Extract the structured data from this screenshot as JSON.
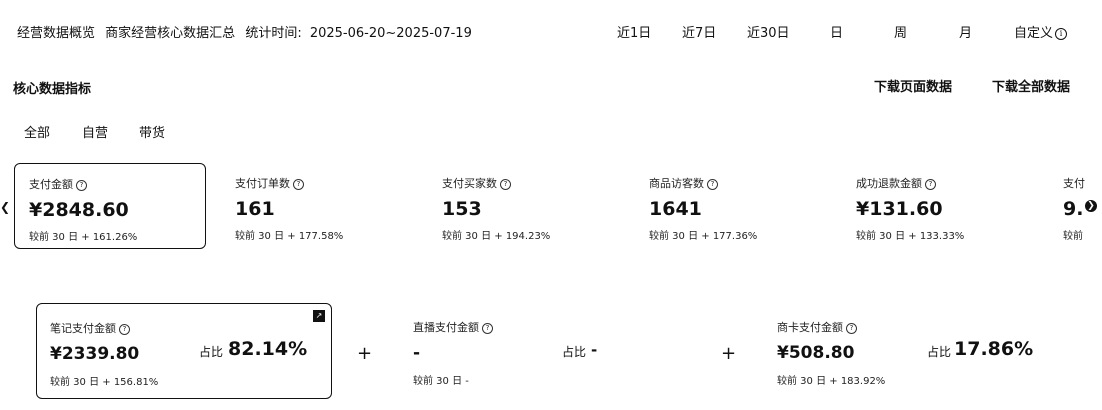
{
  "header": {
    "title": "经营数据概览",
    "subtitle": "商家经营核心数据汇总",
    "time_label": "统计时间:",
    "time_range": "2025-06-20~2025-07-19"
  },
  "time_filters": [
    "近1日",
    "近7日",
    "近30日",
    "日",
    "周",
    "月",
    "自定义"
  ],
  "section": {
    "title": "核心数据指标",
    "download_page": "下载页面数据",
    "download_all": "下载全部数据"
  },
  "filters": [
    "全部",
    "自营",
    "带货"
  ],
  "metrics": [
    {
      "label": "支付金额",
      "value": "¥2848.60",
      "compare": "较前 30 日 + 161.26%"
    },
    {
      "label": "支付订单数",
      "value": "161",
      "compare": "较前 30 日 + 177.58%"
    },
    {
      "label": "支付买家数",
      "value": "153",
      "compare": "较前 30 日 + 194.23%"
    },
    {
      "label": "商品访客数",
      "value": "1641",
      "compare": "较前 30 日 + 177.36%"
    },
    {
      "label": "成功退款金额",
      "value": "¥131.60",
      "compare": "较前 30 日 + 133.33%"
    },
    {
      "label": "支付",
      "value": "9.",
      "compare": "较前"
    }
  ],
  "breakdown": [
    {
      "label": "笔记支付金额",
      "value": "¥2339.80",
      "compare": "较前 30 日 + 156.81%",
      "share_label": "占比",
      "share": "82.14%"
    },
    {
      "label": "直播支付金额",
      "value": "-",
      "compare": "较前 30 日 -",
      "share_label": "占比",
      "share": "-"
    },
    {
      "label": "商卡支付金额",
      "value": "¥508.80",
      "compare": "较前 30 日 + 183.92%",
      "share_label": "占比",
      "share": "17.86%"
    }
  ],
  "icons": {
    "info": "info-icon",
    "question": "question-icon",
    "chevron_left": "chevron-left-icon",
    "chevron_right": "chevron-right-icon",
    "plus": "plus-icon",
    "expand": "expand-icon"
  }
}
